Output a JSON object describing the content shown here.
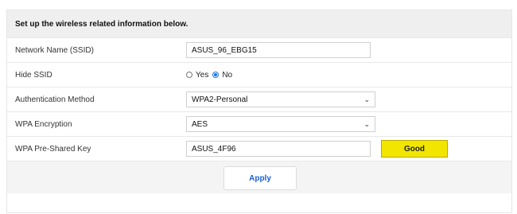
{
  "header": {
    "title": "Set up the wireless related information below."
  },
  "fields": {
    "ssid": {
      "label": "Network Name (SSID)",
      "value": "ASUS_96_EBG15"
    },
    "hide_ssid": {
      "label": "Hide SSID",
      "options": [
        "Yes",
        "No"
      ],
      "selected": "No"
    },
    "auth_method": {
      "label": "Authentication Method",
      "value": "WPA2-Personal"
    },
    "wpa_encryption": {
      "label": "WPA Encryption",
      "value": "AES"
    },
    "psk": {
      "label": "WPA Pre-Shared Key",
      "value": "ASUS_4F96",
      "strength": "Good"
    }
  },
  "footer": {
    "apply_label": "Apply"
  },
  "colors": {
    "strength_bg": "#f2e600",
    "accent": "#1a5fd1",
    "radio_checked": "#1a73e8"
  },
  "icons": [
    "chevron-down-icon"
  ]
}
